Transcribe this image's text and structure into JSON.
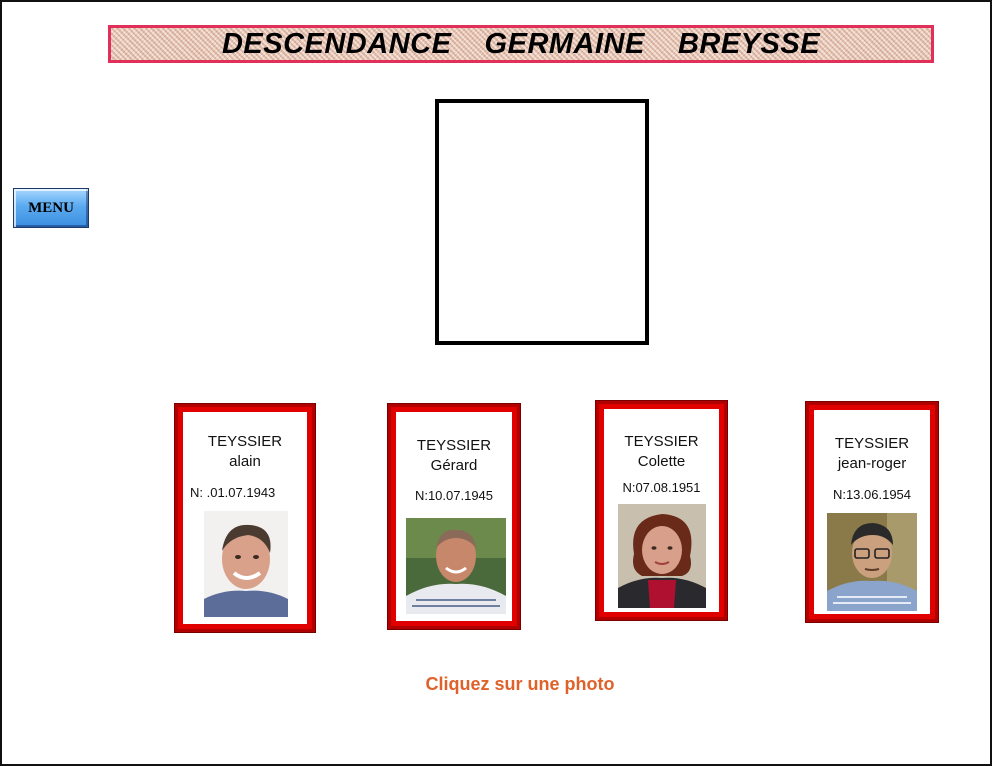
{
  "title": "DESCENDANCE  GERMAINE  BREYSSE",
  "menu": {
    "label": "MENU"
  },
  "instruction": "Cliquez sur une photo",
  "people": [
    {
      "surname": "TEYSSIER",
      "firstname": "alain",
      "birth": "N: .01.07.1943"
    },
    {
      "surname": "TEYSSIER",
      "firstname": "Gérard",
      "birth": "N:10.07.1945"
    },
    {
      "surname": "TEYSSIER",
      "firstname": "Colette",
      "birth": "N:07.08.1951"
    },
    {
      "surname": "TEYSSIER",
      "firstname": "jean-roger",
      "birth": "N:13.06.1954"
    }
  ],
  "colors": {
    "banner_border": "#e0305a",
    "card_border": "#d00000",
    "instruction": "#e0622b",
    "menu_button": "#5aaaf0"
  }
}
